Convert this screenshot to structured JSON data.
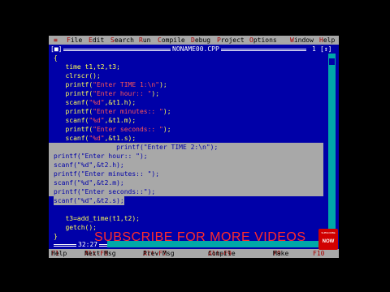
{
  "menu": {
    "system": "≡",
    "items": [
      "File",
      "Edit",
      "Search",
      "Run",
      "Compile",
      "Debug",
      "Project",
      "Options",
      "Window",
      "Help"
    ]
  },
  "window": {
    "close_box": "[■]",
    "title": "NONAME00.CPP",
    "number": "1",
    "zoom_box": "[↕]"
  },
  "code_lines": [
    {
      "text": "{",
      "selected": false
    },
    {
      "text": "   time t1,t2,t3;",
      "selected": false
    },
    {
      "text": "   clrscr();",
      "selected": false
    },
    {
      "text": "   printf(\"Enter TIME 1:\\n\");",
      "selected": false
    },
    {
      "text": "   printf(\"Enter hour:: \");",
      "selected": false
    },
    {
      "text": "   scanf(\"%d\",&t1.h);",
      "selected": false
    },
    {
      "text": "   printf(\"Enter minutes:: \");",
      "selected": false
    },
    {
      "text": "   scanf(\"%d\",&t1.m);",
      "selected": false
    },
    {
      "text": "   printf(\"Enter seconds:: \");",
      "selected": false
    },
    {
      "text": "   scanf(\"%d\",&t1.s);",
      "selected": false
    },
    {
      "text": "                printf(\"Enter TIME 2:\\n\");",
      "selected": true
    },
    {
      "text": "printf(\"Enter hour:: \");",
      "selected": true
    },
    {
      "text": "scanf(\"%d\",&t2.h);",
      "selected": true
    },
    {
      "text": "printf(\"Enter minutes:: \");",
      "selected": true
    },
    {
      "text": "scanf(\"%d\",&t2.m);",
      "selected": true
    },
    {
      "text": "printf(\"Enter seconds::\");",
      "selected": true
    },
    {
      "text": "scanf(\"%d\",&t2.s);",
      "selected": true,
      "partial": true
    },
    {
      "text": "",
      "selected": false
    },
    {
      "text": "   t3=add_time(t1,t2);",
      "selected": false
    },
    {
      "text": "   getch();",
      "selected": false
    },
    {
      "text": "}",
      "selected": false
    }
  ],
  "status": {
    "cursor_pos": "32:27"
  },
  "function_keys": [
    {
      "key": "F1",
      "label": "Help"
    },
    {
      "key": "Alt-F8",
      "label": "Next Msg"
    },
    {
      "key": "Alt-F7",
      "label": "Prev Msg"
    },
    {
      "key": "Alt-F9",
      "label": "Compile"
    },
    {
      "key": "F9",
      "label": "Make"
    },
    {
      "key": "F10",
      "label": ""
    }
  ],
  "overlay": {
    "text": "SUBSCRIBE FOR MORE VIDEOS"
  },
  "badge": {
    "small_text": "SUBSCRIBE",
    "text": "NOW"
  },
  "colors": {
    "editor_bg": "#0000a8",
    "code_text": "#ffff55",
    "string_text": "#ff5555",
    "selection_bg": "#a8a8a8",
    "menu_bg": "#a8a8a8",
    "hotkey": "#a80000",
    "scrollbar": "#00a8a8",
    "overlay_text": "#ff2b2b"
  }
}
